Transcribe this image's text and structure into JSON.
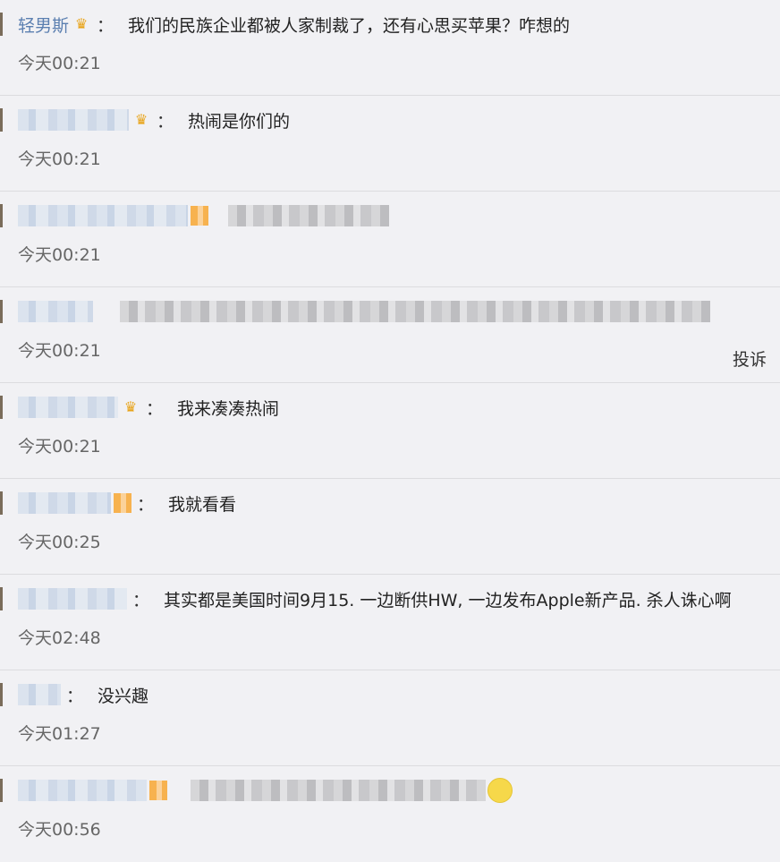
{
  "comments": [
    {
      "user": "轻男斯",
      "text": "我们的民族企业都被人家制裁了，还有心思买苹果？咋想的",
      "time": "今天00:21"
    },
    {
      "user": "",
      "text": "热闹是你们的",
      "time": "今天00:21"
    },
    {
      "user": "",
      "text": "",
      "time": "今天00:21"
    },
    {
      "user": "",
      "text": "",
      "time": "今天00:21",
      "report": "投诉"
    },
    {
      "user": "",
      "text": "我来凑凑热闹",
      "time": "今天00:21"
    },
    {
      "user": "",
      "text": "我就看看",
      "time": "今天00:25"
    },
    {
      "user": "",
      "text": "其实都是美国时间9月15. 一边断供HW, 一边发布Apple新产品. 杀人诛心啊",
      "time": "今天02:48"
    },
    {
      "user": "",
      "text": "没兴趣",
      "time": "今天01:27"
    },
    {
      "user": "",
      "text": "",
      "time": "今天00:56"
    }
  ],
  "colon": "：",
  "icons": {
    "crown": "crown-icon",
    "smiley": "smiley-icon"
  },
  "colors": {
    "username": "#5b7fb0",
    "background": "#f1f1f4",
    "crown": "#e8a317"
  }
}
